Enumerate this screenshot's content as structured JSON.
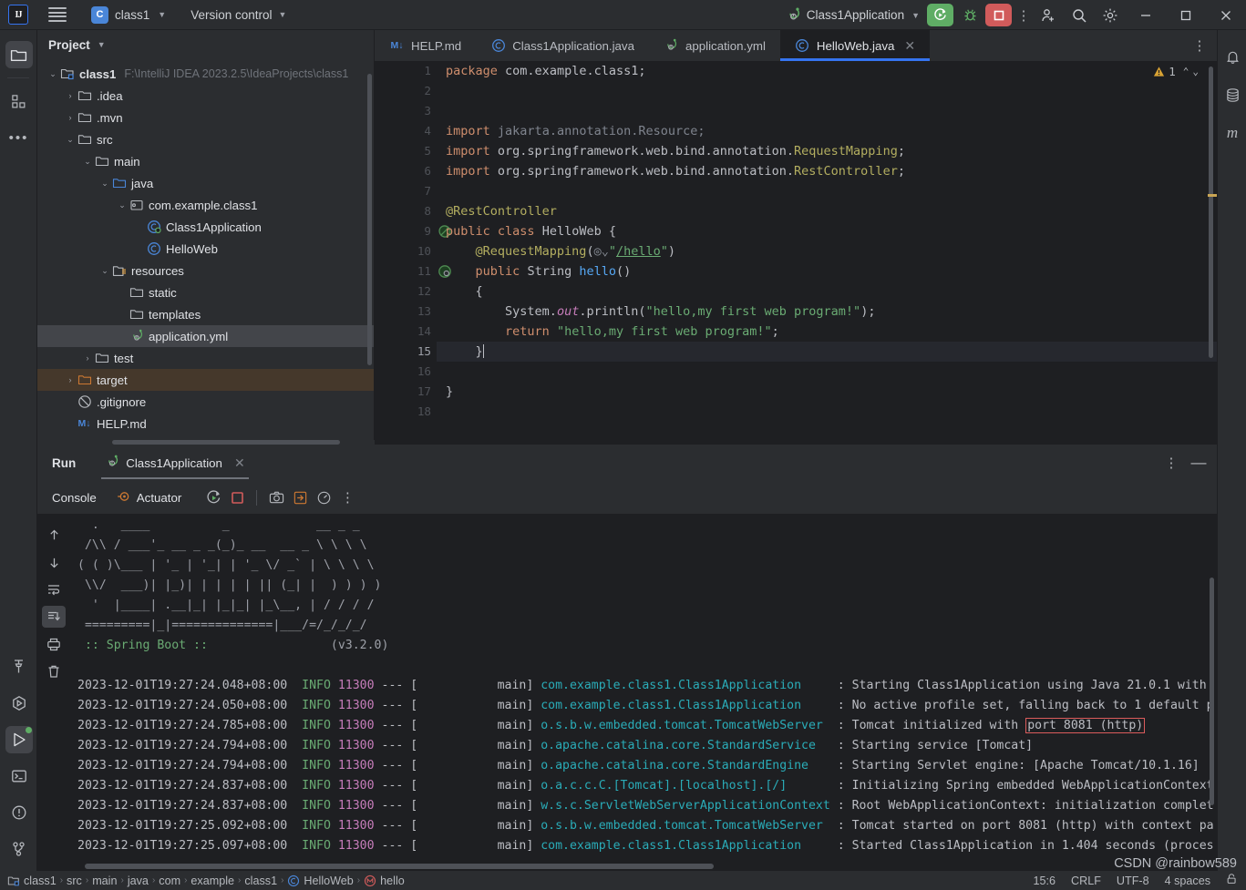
{
  "titlebar": {
    "logo": "IJ",
    "project_name": "class1",
    "project_initial": "C",
    "vcs_label": "Version control",
    "run_config": "Class1Application",
    "icons": [
      "run-icon",
      "debug-icon",
      "stop-icon",
      "more-actions-icon",
      "add-user-icon",
      "search-icon",
      "settings-icon",
      "minimize-icon",
      "maximize-icon",
      "close-icon"
    ]
  },
  "left_rail": [
    {
      "name": "project-tool-icon",
      "glyph": "folder"
    },
    {
      "name": "structure-tool-icon",
      "glyph": "blocks"
    },
    {
      "name": "more-tool-windows-icon",
      "glyph": "dots"
    },
    {
      "name": "build-tool-icon",
      "glyph": "hammer"
    },
    {
      "name": "services-tool-icon",
      "glyph": "hex-play"
    },
    {
      "name": "run-tool-icon",
      "glyph": "play"
    },
    {
      "name": "terminal-tool-icon",
      "glyph": "terminal"
    },
    {
      "name": "problems-tool-icon",
      "glyph": "warning-circle"
    },
    {
      "name": "version-control-tool-icon",
      "glyph": "branch"
    }
  ],
  "right_rail": [
    {
      "name": "notifications-icon",
      "glyph": "bell"
    },
    {
      "name": "database-icon",
      "glyph": "database"
    },
    {
      "name": "maven-icon",
      "glyph": "m"
    }
  ],
  "project_panel": {
    "title": "Project",
    "tree": [
      {
        "depth": 0,
        "arrow": "down",
        "icon": "module-icon",
        "label": "class1",
        "bold": true,
        "path": "F:\\IntelliJ IDEA 2023.2.5\\IdeaProjects\\class1",
        "state": "normal"
      },
      {
        "depth": 1,
        "arrow": "right",
        "icon": "folder-icon",
        "label": ".idea",
        "state": "normal"
      },
      {
        "depth": 1,
        "arrow": "right",
        "icon": "folder-icon",
        "label": ".mvn",
        "state": "normal"
      },
      {
        "depth": 1,
        "arrow": "down",
        "icon": "folder-icon",
        "label": "src",
        "state": "normal"
      },
      {
        "depth": 2,
        "arrow": "down",
        "icon": "folder-icon",
        "label": "main",
        "state": "normal"
      },
      {
        "depth": 3,
        "arrow": "down",
        "icon": "source-folder-icon",
        "label": "java",
        "state": "normal"
      },
      {
        "depth": 4,
        "arrow": "down",
        "icon": "package-icon",
        "label": "com.example.class1",
        "state": "normal"
      },
      {
        "depth": 5,
        "arrow": "none",
        "icon": "spring-class-icon",
        "label": "Class1Application",
        "state": "normal"
      },
      {
        "depth": 5,
        "arrow": "none",
        "icon": "java-class-icon",
        "label": "HelloWeb",
        "state": "normal"
      },
      {
        "depth": 3,
        "arrow": "down",
        "icon": "resources-folder-icon",
        "label": "resources",
        "state": "normal"
      },
      {
        "depth": 4,
        "arrow": "none",
        "icon": "folder-icon",
        "label": "static",
        "state": "normal"
      },
      {
        "depth": 4,
        "arrow": "none",
        "icon": "folder-icon",
        "label": "templates",
        "state": "normal"
      },
      {
        "depth": 4,
        "arrow": "none",
        "icon": "spring-yml-icon",
        "label": "application.yml",
        "state": "selected"
      },
      {
        "depth": 2,
        "arrow": "right",
        "icon": "folder-icon",
        "label": "test",
        "state": "normal"
      },
      {
        "depth": 1,
        "arrow": "right",
        "icon": "excluded-folder-icon",
        "label": "target",
        "state": "target"
      },
      {
        "depth": 1,
        "arrow": "none",
        "icon": "gitignore-icon",
        "label": ".gitignore",
        "state": "normal"
      },
      {
        "depth": 1,
        "arrow": "none",
        "icon": "markdown-icon",
        "label": "HELP.md",
        "state": "normal"
      }
    ]
  },
  "editor": {
    "tabs": [
      {
        "label": "HELP.md",
        "icon": "markdown-icon",
        "active": false,
        "closable": false
      },
      {
        "label": "Class1Application.java",
        "icon": "java-class-icon",
        "active": false,
        "closable": false
      },
      {
        "label": "application.yml",
        "icon": "spring-yml-icon",
        "active": false,
        "closable": false
      },
      {
        "label": "HelloWeb.java",
        "icon": "java-class-icon",
        "active": true,
        "closable": true
      }
    ],
    "warning_count": "1",
    "line_count": 18,
    "current_line": 15,
    "gutter_marks": [
      {
        "line": 9,
        "icon": "spring-bean-icon"
      },
      {
        "line": 11,
        "icon": "spring-endpoint-icon"
      }
    ],
    "code": [
      {
        "n": 1,
        "text": "package com.example.class1;"
      },
      {
        "n": 2,
        "text": ""
      },
      {
        "n": 3,
        "text": ""
      },
      {
        "n": 4,
        "text": "import jakarta.annotation.Resource;"
      },
      {
        "n": 5,
        "text": "import org.springframework.web.bind.annotation.RequestMapping;"
      },
      {
        "n": 6,
        "text": "import org.springframework.web.bind.annotation.RestController;"
      },
      {
        "n": 7,
        "text": ""
      },
      {
        "n": 8,
        "text": "@RestController"
      },
      {
        "n": 9,
        "text": "public class HelloWeb {"
      },
      {
        "n": 10,
        "text": "    @RequestMapping(\"/hello\")"
      },
      {
        "n": 11,
        "text": "    public String hello()"
      },
      {
        "n": 12,
        "text": "    {"
      },
      {
        "n": 13,
        "text": "        System.out.println(\"hello,my first web program!\");"
      },
      {
        "n": 14,
        "text": "        return \"hello,my first web program!\";"
      },
      {
        "n": 15,
        "text": "    }"
      },
      {
        "n": 16,
        "text": ""
      },
      {
        "n": 17,
        "text": "}"
      },
      {
        "n": 18,
        "text": ""
      }
    ]
  },
  "run_panel": {
    "title": "Run",
    "tab_label": "Class1Application",
    "console_label": "Console",
    "actuator_label": "Actuator",
    "toolbar_icons": [
      "rerun-icon",
      "stop-icon",
      "screenshot-icon",
      "export-icon",
      "profiler-icon",
      "more-icon"
    ],
    "side_icons": [
      "scroll-up-icon",
      "scroll-down-icon",
      "soft-wrap-icon",
      "scroll-to-end-icon",
      "print-icon",
      "clear-all-icon"
    ],
    "banner": [
      "  .   ____          _            __ _ _",
      " /\\\\ / ___'_ __ _ _(_)_ __  __ _ \\ \\ \\ \\",
      "( ( )\\___ | '_ | '_| | '_ \\/ _` | \\ \\ \\ \\",
      " \\\\/  ___)| |_)| | | | | || (_| |  ) ) ) )",
      "  '  |____| .__|_| |_|_| |_\\__, | / / / /",
      " =========|_|==============|___/=/_/_/_/"
    ],
    "banner_footer_left": " :: Spring Boot :: ",
    "banner_footer_right": "(v3.2.0)",
    "logs": [
      {
        "ts": "2023-12-01T19:27:24.048+08:00",
        "level": "INFO",
        "pid": "11300",
        "thread": "main",
        "logger": "com.example.class1.Class1Application",
        "msg": "Starting Class1Application using Java 21.0.1 with"
      },
      {
        "ts": "2023-12-01T19:27:24.050+08:00",
        "level": "INFO",
        "pid": "11300",
        "thread": "main",
        "logger": "com.example.class1.Class1Application",
        "msg": "No active profile set, falling back to 1 default p"
      },
      {
        "ts": "2023-12-01T19:27:24.785+08:00",
        "level": "INFO",
        "pid": "11300",
        "thread": "main",
        "logger": "o.s.b.w.embedded.tomcat.TomcatWebServer",
        "msg": "Tomcat initialized with ",
        "highlight": "port 8081 (http)"
      },
      {
        "ts": "2023-12-01T19:27:24.794+08:00",
        "level": "INFO",
        "pid": "11300",
        "thread": "main",
        "logger": "o.apache.catalina.core.StandardService",
        "msg": "Starting service [Tomcat]"
      },
      {
        "ts": "2023-12-01T19:27:24.794+08:00",
        "level": "INFO",
        "pid": "11300",
        "thread": "main",
        "logger": "o.apache.catalina.core.StandardEngine",
        "msg": "Starting Servlet engine: [Apache Tomcat/10.1.16]"
      },
      {
        "ts": "2023-12-01T19:27:24.837+08:00",
        "level": "INFO",
        "pid": "11300",
        "thread": "main",
        "logger": "o.a.c.c.C.[Tomcat].[localhost].[/]",
        "msg": "Initializing Spring embedded WebApplicationContext"
      },
      {
        "ts": "2023-12-01T19:27:24.837+08:00",
        "level": "INFO",
        "pid": "11300",
        "thread": "main",
        "logger": "w.s.c.ServletWebServerApplicationContext",
        "msg": "Root WebApplicationContext: initialization complet"
      },
      {
        "ts": "2023-12-01T19:27:25.092+08:00",
        "level": "INFO",
        "pid": "11300",
        "thread": "main",
        "logger": "o.s.b.w.embedded.tomcat.TomcatWebServer",
        "msg": "Tomcat started on port 8081 (http) with context pa"
      },
      {
        "ts": "2023-12-01T19:27:25.097+08:00",
        "level": "INFO",
        "pid": "11300",
        "thread": "main",
        "logger": "com.example.class1.Class1Application",
        "msg": "Started Class1Application in 1.404 seconds (proces"
      }
    ]
  },
  "status_bar": {
    "breadcrumbs": [
      {
        "label": "class1",
        "icon": "module-icon"
      },
      {
        "label": "src",
        "icon": "none"
      },
      {
        "label": "main",
        "icon": "none"
      },
      {
        "label": "java",
        "icon": "none"
      },
      {
        "label": "com",
        "icon": "none"
      },
      {
        "label": "example",
        "icon": "none"
      },
      {
        "label": "class1",
        "icon": "none"
      },
      {
        "label": "HelloWeb",
        "icon": "java-class-icon"
      },
      {
        "label": "hello",
        "icon": "method-icon"
      }
    ],
    "caret_position": "15:6",
    "line_separator": "CRLF",
    "encoding": "UTF-8",
    "indent": "4 spaces",
    "lock_icon": "read-only-icon"
  },
  "watermark": "CSDN @rainbow589",
  "colors": {
    "accent": "#3574f0",
    "run_green": "#5fad65",
    "stop_red": "#d15b5b",
    "bg_panel": "#2b2d30",
    "bg_editor": "#1e1f22",
    "highlight_red": "#db5c5c"
  }
}
